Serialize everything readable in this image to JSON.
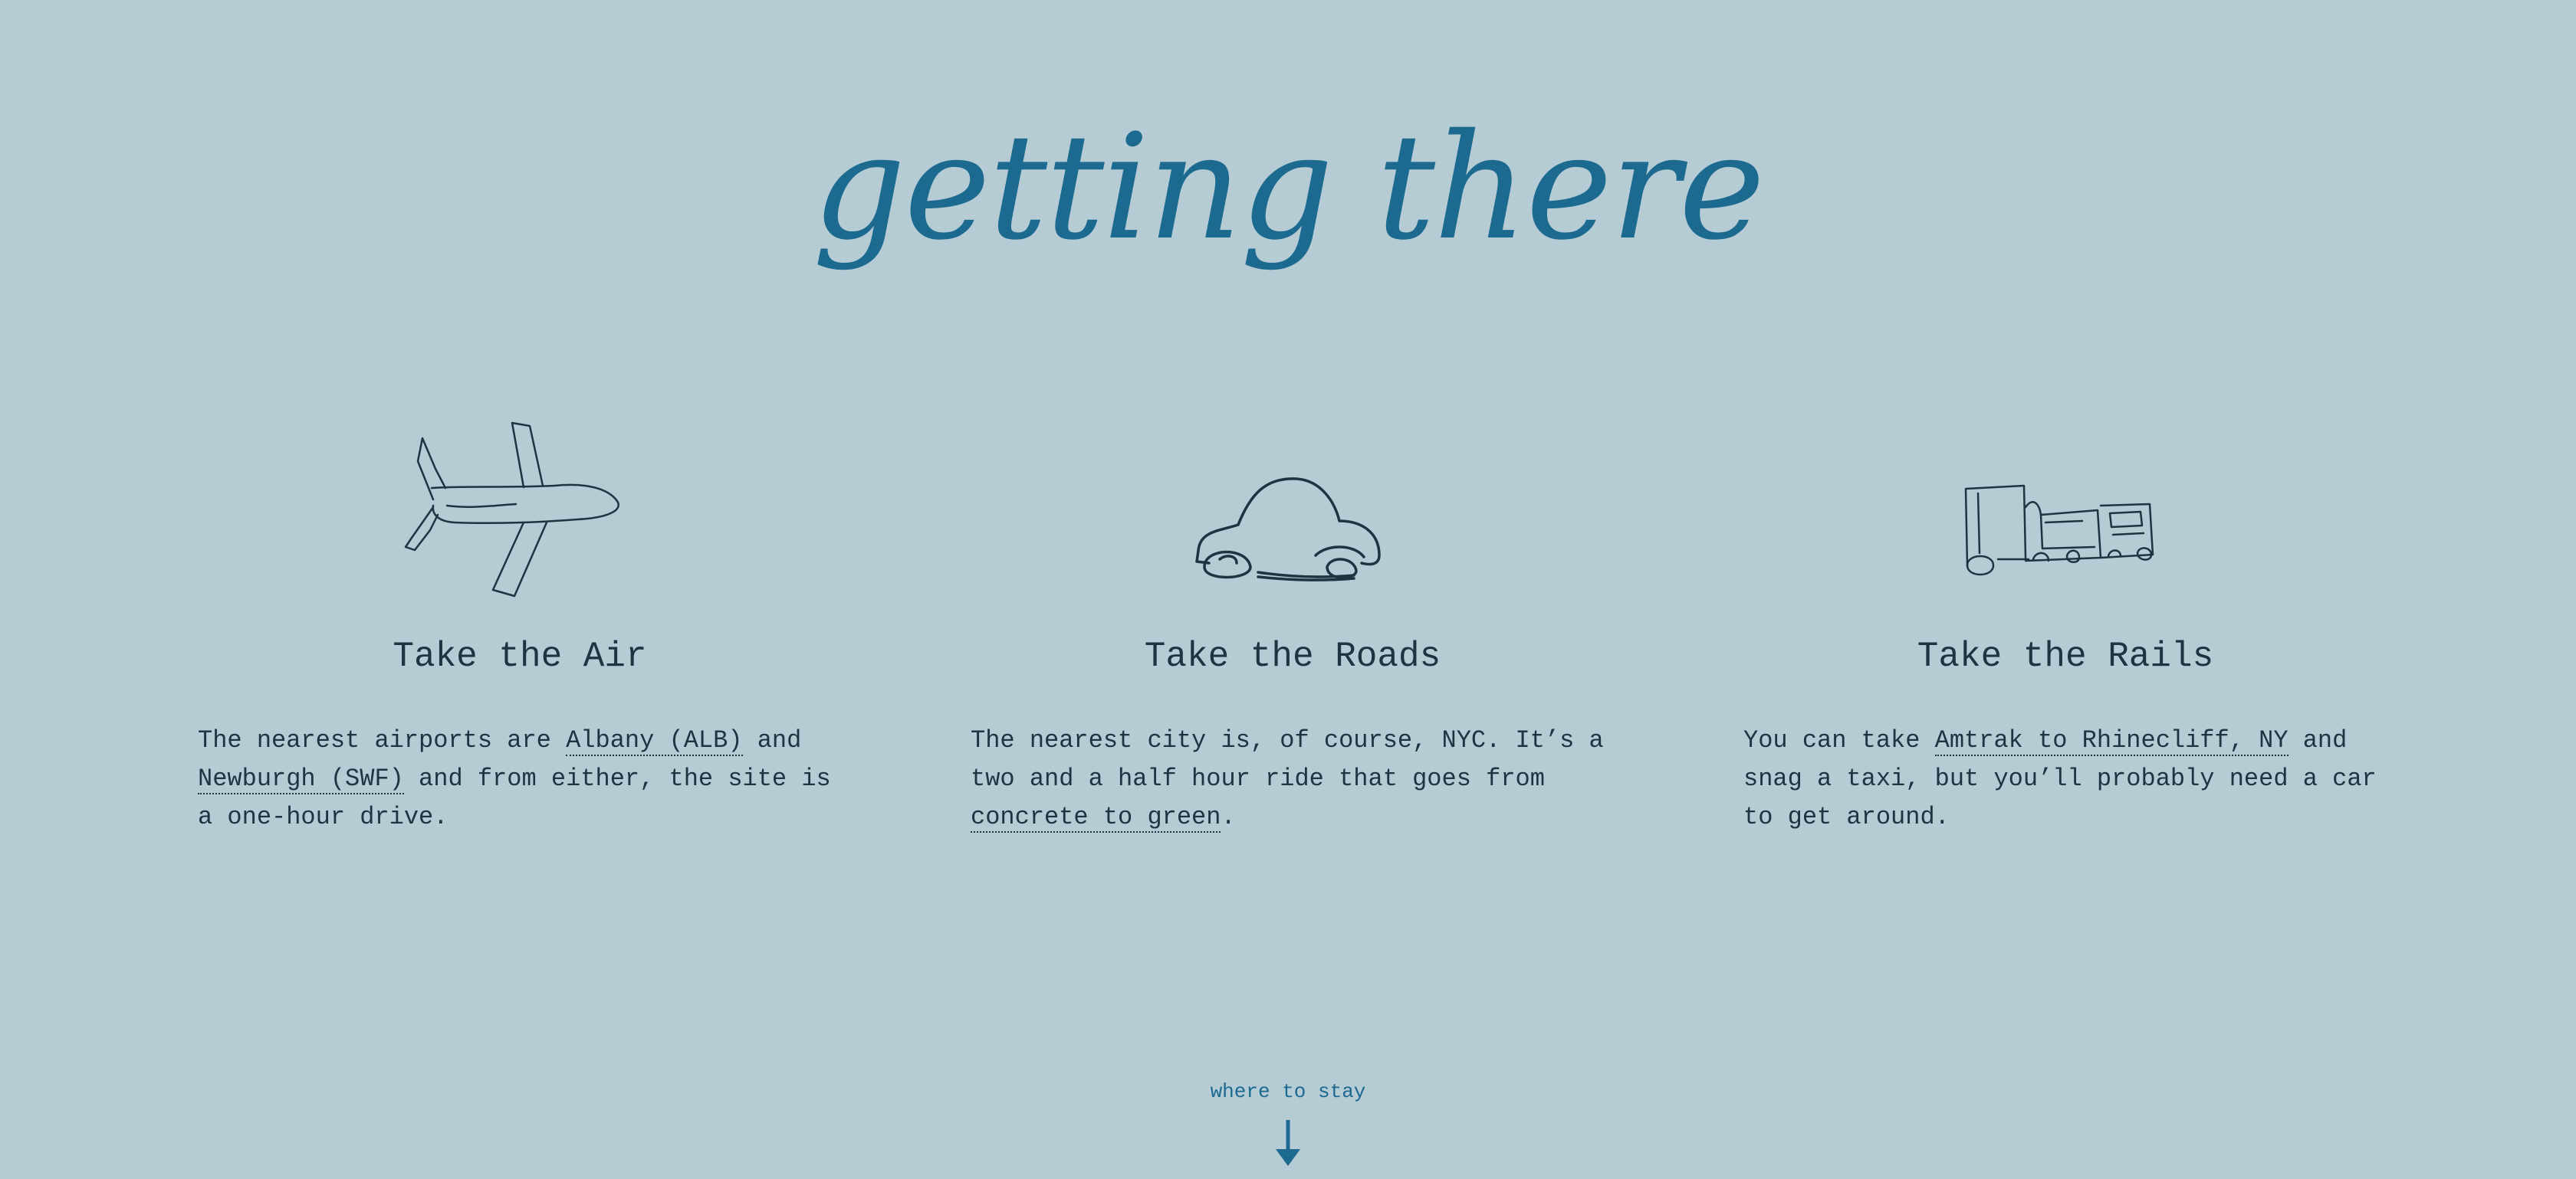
{
  "page": {
    "title": "getting there",
    "background": "#b5ccd4",
    "accent": "#1d6a91",
    "ink": "#1d3540"
  },
  "columns": {
    "air": {
      "icon": "airplane-sketch-icon",
      "heading": "Take the Air",
      "text_1": "The nearest airports are ",
      "link_1": "Albany (ALB)",
      "text_2": " and ",
      "link_2": "Newburgh (SWF)",
      "text_3": " and from either, the site is a one-hour drive."
    },
    "roads": {
      "icon": "car-sketch-icon",
      "heading": "Take the Roads",
      "text_1": "The nearest city is, of course, NYC. It’s a two and a half hour ride that goes from ",
      "link_1": "concrete to green",
      "text_2": "."
    },
    "rails": {
      "icon": "train-sketch-icon",
      "heading": "Take the Rails",
      "text_1": "You can take ",
      "link_1": "Amtrak to Rhinecliff, NY",
      "text_2": " and snag a taxi, but you’ll probably need a car to get around."
    }
  },
  "footer": {
    "next_label": "where to stay",
    "arrow_icon": "arrow-down-icon"
  }
}
